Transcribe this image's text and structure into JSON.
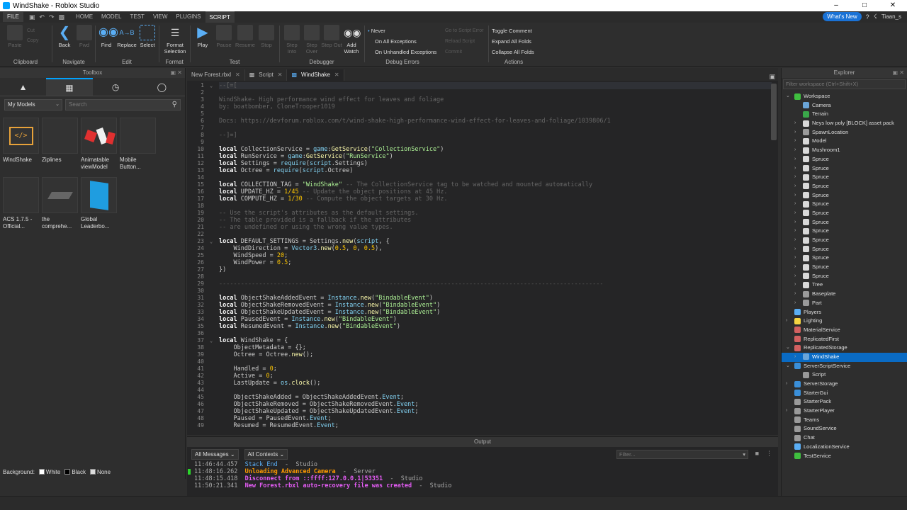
{
  "window": {
    "title": "WindShake - Roblox Studio",
    "controls": [
      "–",
      "□",
      "✕"
    ]
  },
  "menu": {
    "file": "FILE",
    "tabs": [
      "HOME",
      "MODEL",
      "TEST",
      "VIEW",
      "PLUGINS",
      "SCRIPT"
    ],
    "whats_new": "What's New",
    "user": "Tiaan_s"
  },
  "ribbon": {
    "clipboard": {
      "label": "Clipboard",
      "paste": "Paste",
      "cut": "Cut",
      "copy": "Copy"
    },
    "navigate": {
      "label": "Navigate",
      "back": "Back",
      "fwd": "Fwd"
    },
    "edit": {
      "label": "Edit",
      "find": "Find",
      "replace": "Replace",
      "select": "Select"
    },
    "format": {
      "label": "Format",
      "format_selection": "Format Selection"
    },
    "test": {
      "label": "Test",
      "play": "Play",
      "pause": "Pause",
      "resume": "Resume",
      "stop": "Stop"
    },
    "debugger": {
      "label": "Debugger",
      "step_into": "Step Into",
      "step_over": "Step Over",
      "step_out": "Step Out",
      "add_watch": "Add Watch"
    },
    "debug_errors": {
      "label": "Debug Errors",
      "never": "Never",
      "all": "On All Exceptions",
      "unhandled": "On Unhandled Exceptions"
    },
    "gray": {
      "go_to_script": "Go to Script Error",
      "reload": "Reload Script",
      "commit": "Commit"
    },
    "actions": {
      "label": "Actions",
      "toggle": "Toggle Comment",
      "expand": "Expand All Folds",
      "collapse": "Collapse All Folds"
    }
  },
  "toolbox": {
    "title": "Toolbox",
    "category": "My Models",
    "search_placeholder": "Search",
    "items": [
      {
        "name": "WindShake"
      },
      {
        "name": "Ziplines"
      },
      {
        "name": "Animatable viewModel"
      },
      {
        "name": "Mobile Button..."
      },
      {
        "name": "ACS 1.7.5 - Official..."
      },
      {
        "name": "the comprehe..."
      },
      {
        "name": "Global Leaderbo..."
      }
    ],
    "background": {
      "label": "Background:",
      "white": "White",
      "black": "Black",
      "none": "None"
    }
  },
  "editor": {
    "tabs": [
      {
        "label": "New Forest.rbxl"
      },
      {
        "label": "Script"
      },
      {
        "label": "WindShake"
      }
    ],
    "line_count": 49,
    "fold_lines": [
      1,
      23,
      37
    ],
    "lines": [
      [
        [
          "cm",
          "--[=["
        ]
      ],
      [],
      [
        [
          "cm",
          "WindShake- High performance wind effect for leaves and foliage"
        ]
      ],
      [
        [
          "cm",
          "by: boatbomber, CloneTrooper1019"
        ]
      ],
      [],
      [
        [
          "cm",
          "Docs: https://devforum.roblox.com/t/wind-shake-high-performance-wind-effect-for-leaves-and-foliage/1039806/1"
        ]
      ],
      [],
      [
        [
          "cm",
          "--]=]"
        ]
      ],
      [],
      [
        [
          "kw",
          "local"
        ],
        [
          "op",
          " CollectionService = "
        ],
        [
          "bi",
          "game"
        ],
        [
          "op",
          ":"
        ],
        [
          "fn",
          "GetService"
        ],
        [
          "op",
          "("
        ],
        [
          "str",
          "\"CollectionService\""
        ],
        [
          "op",
          ")"
        ]
      ],
      [
        [
          "kw",
          "local"
        ],
        [
          "op",
          " RunService = "
        ],
        [
          "bi",
          "game"
        ],
        [
          "op",
          ":"
        ],
        [
          "fn",
          "GetService"
        ],
        [
          "op",
          "("
        ],
        [
          "str",
          "\"RunService\""
        ],
        [
          "op",
          ")"
        ]
      ],
      [
        [
          "kw",
          "local"
        ],
        [
          "op",
          " Settings = "
        ],
        [
          "bi",
          "require"
        ],
        [
          "op",
          "("
        ],
        [
          "bi",
          "script"
        ],
        [
          "op",
          ".Settings)"
        ]
      ],
      [
        [
          "kw",
          "local"
        ],
        [
          "op",
          " Octree = "
        ],
        [
          "bi",
          "require"
        ],
        [
          "op",
          "("
        ],
        [
          "bi",
          "script"
        ],
        [
          "op",
          ".Octree)"
        ]
      ],
      [],
      [
        [
          "kw",
          "local"
        ],
        [
          "op",
          " COLLECTION_TAG = "
        ],
        [
          "str",
          "\"WindShake\""
        ],
        [
          "cm",
          " -- The CollectionService tag to be watched and mounted automatically"
        ]
      ],
      [
        [
          "kw",
          "local"
        ],
        [
          "op",
          " UPDATE_HZ = "
        ],
        [
          "num",
          "1/45"
        ],
        [
          "cm",
          " -- Update the object positions at 45 Hz."
        ]
      ],
      [
        [
          "kw",
          "local"
        ],
        [
          "op",
          " COMPUTE_HZ = "
        ],
        [
          "num",
          "1/30"
        ],
        [
          "cm",
          " -- Compute the object targets at 30 Hz."
        ]
      ],
      [],
      [
        [
          "cm",
          "-- Use the script's attributes as the default settings."
        ]
      ],
      [
        [
          "cm",
          "-- The table provided is a fallback if the attributes"
        ]
      ],
      [
        [
          "cm",
          "-- are undefined or using the wrong value types."
        ]
      ],
      [],
      [
        [
          "kw",
          "local"
        ],
        [
          "op",
          " DEFAULT_SETTINGS = Settings."
        ],
        [
          "fn",
          "new"
        ],
        [
          "op",
          "("
        ],
        [
          "bi",
          "script"
        ],
        [
          "op",
          ", {"
        ]
      ],
      [
        [
          "op",
          "    WindDirection = "
        ],
        [
          "bi",
          "Vector3"
        ],
        [
          "op",
          "."
        ],
        [
          "fn",
          "new"
        ],
        [
          "op",
          "("
        ],
        [
          "num",
          "0.5"
        ],
        [
          "op",
          ", "
        ],
        [
          "num",
          "0"
        ],
        [
          "op",
          ", "
        ],
        [
          "num",
          "0.5"
        ],
        [
          "op",
          "),"
        ]
      ],
      [
        [
          "op",
          "    WindSpeed = "
        ],
        [
          "num",
          "20"
        ],
        [
          "op",
          ";"
        ]
      ],
      [
        [
          "op",
          "    WindPower = "
        ],
        [
          "num",
          "0.5"
        ],
        [
          "op",
          ";"
        ]
      ],
      [
        [
          "op",
          "})"
        ]
      ],
      [],
      [
        [
          "dash",
          "----------------------------------------------------------------------------------------------------------"
        ]
      ],
      [],
      [
        [
          "kw",
          "local"
        ],
        [
          "op",
          " ObjectShakeAddedEvent = "
        ],
        [
          "bi",
          "Instance"
        ],
        [
          "op",
          "."
        ],
        [
          "fn",
          "new"
        ],
        [
          "op",
          "("
        ],
        [
          "str",
          "\"BindableEvent\""
        ],
        [
          "op",
          ")"
        ]
      ],
      [
        [
          "kw",
          "local"
        ],
        [
          "op",
          " ObjectShakeRemovedEvent = "
        ],
        [
          "bi",
          "Instance"
        ],
        [
          "op",
          "."
        ],
        [
          "fn",
          "new"
        ],
        [
          "op",
          "("
        ],
        [
          "str",
          "\"BindableEvent\""
        ],
        [
          "op",
          ")"
        ]
      ],
      [
        [
          "kw",
          "local"
        ],
        [
          "op",
          " ObjectShakeUpdatedEvent = "
        ],
        [
          "bi",
          "Instance"
        ],
        [
          "op",
          "."
        ],
        [
          "fn",
          "new"
        ],
        [
          "op",
          "("
        ],
        [
          "str",
          "\"BindableEvent\""
        ],
        [
          "op",
          ")"
        ]
      ],
      [
        [
          "kw",
          "local"
        ],
        [
          "op",
          " PausedEvent = "
        ],
        [
          "bi",
          "Instance"
        ],
        [
          "op",
          "."
        ],
        [
          "fn",
          "new"
        ],
        [
          "op",
          "("
        ],
        [
          "str",
          "\"BindableEvent\""
        ],
        [
          "op",
          ")"
        ]
      ],
      [
        [
          "kw",
          "local"
        ],
        [
          "op",
          " ResumedEvent = "
        ],
        [
          "bi",
          "Instance"
        ],
        [
          "op",
          "."
        ],
        [
          "fn",
          "new"
        ],
        [
          "op",
          "("
        ],
        [
          "str",
          "\"BindableEvent\""
        ],
        [
          "op",
          ")"
        ]
      ],
      [],
      [
        [
          "kw",
          "local"
        ],
        [
          "op",
          " WindShake = {"
        ]
      ],
      [
        [
          "op",
          "    ObjectMetadata = {};"
        ]
      ],
      [
        [
          "op",
          "    Octree = Octree."
        ],
        [
          "fn",
          "new"
        ],
        [
          "op",
          "();"
        ]
      ],
      [],
      [
        [
          "op",
          "    Handled = "
        ],
        [
          "num",
          "0"
        ],
        [
          "op",
          ";"
        ]
      ],
      [
        [
          "op",
          "    Active = "
        ],
        [
          "num",
          "0"
        ],
        [
          "op",
          ";"
        ]
      ],
      [
        [
          "op",
          "    LastUpdate = "
        ],
        [
          "bi",
          "os"
        ],
        [
          "op",
          "."
        ],
        [
          "fn",
          "clock"
        ],
        [
          "op",
          "();"
        ]
      ],
      [],
      [
        [
          "op",
          "    ObjectShakeAdded = ObjectShakeAddedEvent."
        ],
        [
          "bi",
          "Event"
        ],
        [
          "op",
          ";"
        ]
      ],
      [
        [
          "op",
          "    ObjectShakeRemoved = ObjectShakeRemovedEvent."
        ],
        [
          "bi",
          "Event"
        ],
        [
          "op",
          ";"
        ]
      ],
      [
        [
          "op",
          "    ObjectShakeUpdated = ObjectShakeUpdatedEvent."
        ],
        [
          "bi",
          "Event"
        ],
        [
          "op",
          ";"
        ]
      ],
      [
        [
          "op",
          "    Paused = PausedEvent."
        ],
        [
          "bi",
          "Event"
        ],
        [
          "op",
          ";"
        ]
      ],
      [
        [
          "op",
          "    Resumed = ResumedEvent."
        ],
        [
          "bi",
          "Event"
        ],
        [
          "op",
          ";"
        ]
      ]
    ]
  },
  "output": {
    "title": "Output",
    "messages_filter": "All Messages",
    "contexts_filter": "All Contexts",
    "filter_placeholder": "Filter...",
    "lines": [
      {
        "time": "11:46:44.457",
        "text": "Stack End",
        "sep": "  -  ",
        "source": "Studio",
        "style": "c-blue"
      },
      {
        "time": "11:48:16.262",
        "text": "Unloading Advanced Camera",
        "sep": "  -  ",
        "source": "Server",
        "style": "c-orange"
      },
      {
        "time": "11:48:15.418",
        "text": "Disconnect from ::ffff:127.0.0.1|53351",
        "sep": "  -  ",
        "source": "Studio",
        "style": "c-pink"
      },
      {
        "time": "11:50:21.341",
        "text": "New Forest.rbxl auto-recovery file was created",
        "sep": "  -  ",
        "source": "Studio",
        "style": "c-pink"
      }
    ]
  },
  "explorer": {
    "title": "Explorer",
    "filter_placeholder": "Filter workspace (Ctrl+Shift+X)",
    "items": [
      {
        "label": "Workspace",
        "depth": 0,
        "exp": "open",
        "icon": "#3fbf3f"
      },
      {
        "label": "Camera",
        "depth": 1,
        "exp": "",
        "icon": "#6aa5d8"
      },
      {
        "label": "Terrain",
        "depth": 1,
        "exp": "",
        "icon": "#3aa84a"
      },
      {
        "label": "Neys low poly [BLOCK] asset pack",
        "depth": 1,
        "exp": "closed",
        "icon": "#d9d9d9"
      },
      {
        "label": "SpawnLocation",
        "depth": 1,
        "exp": "closed",
        "icon": "#9a9a9a"
      },
      {
        "label": "Model",
        "depth": 1,
        "exp": "closed",
        "icon": "#d9d9d9"
      },
      {
        "label": "Mushroom1",
        "depth": 1,
        "exp": "closed",
        "icon": "#d9d9d9"
      },
      {
        "label": "Spruce",
        "depth": 1,
        "exp": "closed",
        "icon": "#d9d9d9"
      },
      {
        "label": "Spruce",
        "depth": 1,
        "exp": "closed",
        "icon": "#d9d9d9"
      },
      {
        "label": "Spruce",
        "depth": 1,
        "exp": "closed",
        "icon": "#d9d9d9"
      },
      {
        "label": "Spruce",
        "depth": 1,
        "exp": "closed",
        "icon": "#d9d9d9"
      },
      {
        "label": "Spruce",
        "depth": 1,
        "exp": "closed",
        "icon": "#d9d9d9"
      },
      {
        "label": "Spruce",
        "depth": 1,
        "exp": "closed",
        "icon": "#d9d9d9"
      },
      {
        "label": "Spruce",
        "depth": 1,
        "exp": "closed",
        "icon": "#d9d9d9"
      },
      {
        "label": "Spruce",
        "depth": 1,
        "exp": "closed",
        "icon": "#d9d9d9"
      },
      {
        "label": "Spruce",
        "depth": 1,
        "exp": "closed",
        "icon": "#d9d9d9"
      },
      {
        "label": "Spruce",
        "depth": 1,
        "exp": "closed",
        "icon": "#d9d9d9"
      },
      {
        "label": "Spruce",
        "depth": 1,
        "exp": "closed",
        "icon": "#d9d9d9"
      },
      {
        "label": "Spruce",
        "depth": 1,
        "exp": "closed",
        "icon": "#d9d9d9"
      },
      {
        "label": "Spruce",
        "depth": 1,
        "exp": "closed",
        "icon": "#d9d9d9"
      },
      {
        "label": "Spruce",
        "depth": 1,
        "exp": "closed",
        "icon": "#d9d9d9"
      },
      {
        "label": "Tree",
        "depth": 1,
        "exp": "closed",
        "icon": "#d9d9d9"
      },
      {
        "label": "Baseplate",
        "depth": 1,
        "exp": "closed",
        "icon": "#9a9a9a"
      },
      {
        "label": "Part",
        "depth": 1,
        "exp": "closed",
        "icon": "#9a9a9a"
      },
      {
        "label": "Players",
        "depth": 0,
        "exp": "",
        "icon": "#5aaef5"
      },
      {
        "label": "Lighting",
        "depth": 0,
        "exp": "closed",
        "icon": "#f5d442"
      },
      {
        "label": "MaterialService",
        "depth": 0,
        "exp": "",
        "icon": "#d16060"
      },
      {
        "label": "ReplicatedFirst",
        "depth": 0,
        "exp": "",
        "icon": "#d16060"
      },
      {
        "label": "ReplicatedStorage",
        "depth": 0,
        "exp": "open",
        "icon": "#d16060"
      },
      {
        "label": "WindShake",
        "depth": 1,
        "exp": "closed",
        "icon": "#6aa5d8",
        "selected": true
      },
      {
        "label": "ServerScriptService",
        "depth": 0,
        "exp": "open",
        "icon": "#3a8fd9"
      },
      {
        "label": "Script",
        "depth": 1,
        "exp": "",
        "icon": "#9a9a9a"
      },
      {
        "label": "ServerStorage",
        "depth": 0,
        "exp": "closed",
        "icon": "#3a8fd9"
      },
      {
        "label": "StarterGui",
        "depth": 0,
        "exp": "",
        "icon": "#3a8fd9"
      },
      {
        "label": "StarterPack",
        "depth": 0,
        "exp": "",
        "icon": "#9a9a9a"
      },
      {
        "label": "StarterPlayer",
        "depth": 0,
        "exp": "closed",
        "icon": "#9a9a9a"
      },
      {
        "label": "Teams",
        "depth": 0,
        "exp": "",
        "icon": "#9a9a9a"
      },
      {
        "label": "SoundService",
        "depth": 0,
        "exp": "",
        "icon": "#9a9a9a"
      },
      {
        "label": "Chat",
        "depth": 0,
        "exp": "",
        "icon": "#9a9a9a"
      },
      {
        "label": "LocalizationService",
        "depth": 0,
        "exp": "",
        "icon": "#5aaef5"
      },
      {
        "label": "TestService",
        "depth": 0,
        "exp": "",
        "icon": "#3fbf3f"
      }
    ]
  }
}
